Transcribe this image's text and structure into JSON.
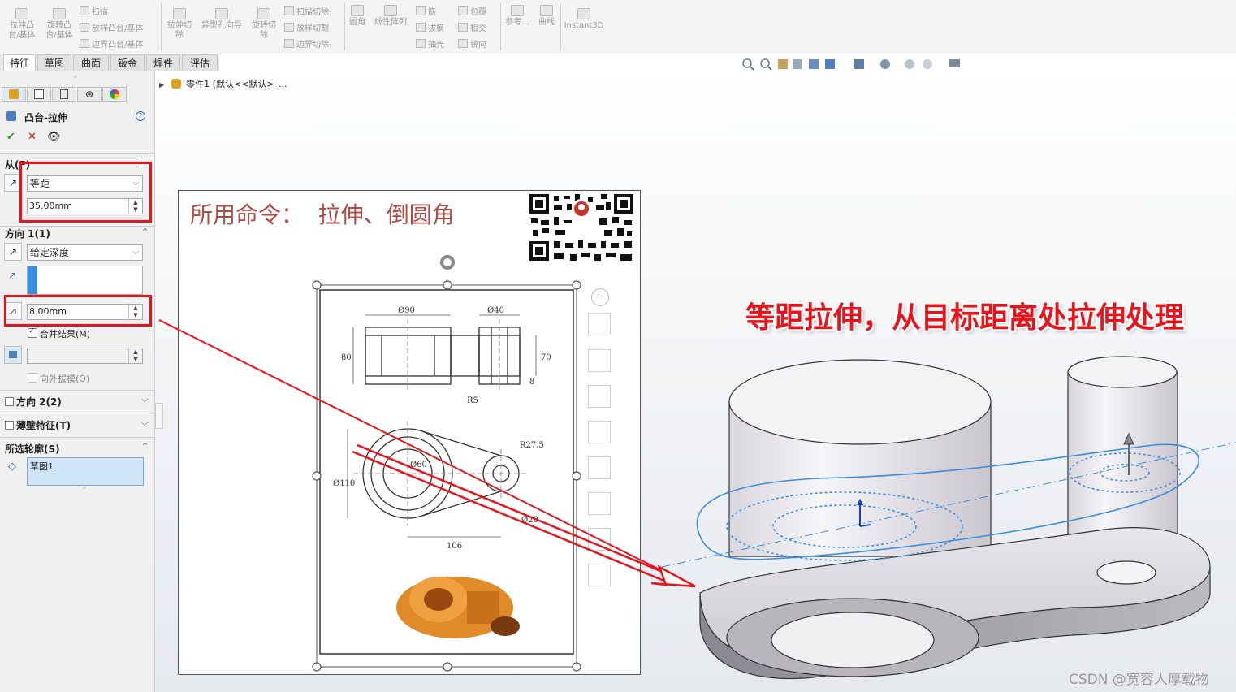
{
  "ribbon": {
    "extrude_boss": "拉伸凸台/基体",
    "revolve_boss": "旋转凸台/基体",
    "sweep": "扫描",
    "loft_boss": "放样凸台/基体",
    "boundary_boss": "边界凸台/基体",
    "extrude_cut": "拉伸切除",
    "hole_wizard": "异型孔向导",
    "revolve_cut": "旋转切除",
    "swept_cut": "扫描切除",
    "lofted_cut": "放样切割",
    "boundary_cut": "边界切除",
    "fillet": "圆角",
    "linear_pattern": "线性阵列",
    "rib": "筋",
    "draft": "拔模",
    "shell": "抽壳",
    "wrap": "包覆",
    "intersect": "相交",
    "mirror": "镜向",
    "reference": "参考...",
    "curves": "曲线",
    "instant3d": "Instant3D"
  },
  "tabs": [
    "特征",
    "草图",
    "曲面",
    "钣金",
    "焊件",
    "评估"
  ],
  "feature_tree": {
    "part_label": "零件1 (默认<<默认>_..."
  },
  "property_manager": {
    "title": "凸台-拉伸",
    "from": {
      "label": "从(F)",
      "condition": "等距",
      "offset_value": "35.00mm"
    },
    "direction1": {
      "label": "方向 1(1)",
      "end_condition": "给定深度",
      "depth_value": "8.00mm",
      "merge_result_label": "合并结果(M)",
      "draft_outward_label": "向外拔模(O)"
    },
    "direction2_label": "方向 2(2)",
    "thin_feature_label": "薄壁特征(T)",
    "selected_contours": {
      "label": "所选轮廓(S)",
      "item": "草图1"
    }
  },
  "overlay_image": {
    "title": "所用命令：  拉伸、倒圆角",
    "drawing_dims": [
      "Ø90",
      "Ø40",
      "80",
      "70",
      "R5",
      "R27.5",
      "Ø110",
      "Ø60",
      "Ø20",
      "106",
      "8"
    ]
  },
  "annotation": "等距拉伸，从目标距离处拉伸处理",
  "watermark": "CSDN @宽容人厚载物",
  "colors": {
    "highlight_red": "#e8141b",
    "annotation_red": "#e8141b",
    "preview_blue": "#3b8de0",
    "drawing_title": "#b24a44"
  }
}
